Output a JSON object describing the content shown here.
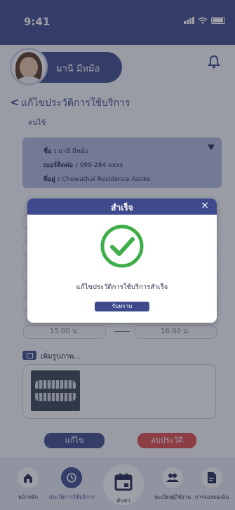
{
  "status_bar": {
    "time": "9:41"
  },
  "profile": {
    "name": "มานี มีหม้อ"
  },
  "page": {
    "back": "<",
    "title": "แก้ไขประวัติการใช้บริการ",
    "patient_section": "คนไข้"
  },
  "patient": {
    "name_label": "ชื่อ :",
    "name_value": "มานี มีหม้อ",
    "phone_label": "เบอร์ติดต่อ :",
    "phone_value": "099-284-xxxx",
    "address_label": "ที่อยู่ :",
    "address_value": "Chewathai Residence Asoke"
  },
  "time_range": {
    "start": "15:00 น.",
    "end": "16:00 น."
  },
  "photo": {
    "add_label": "เพิ่มรูปภาพ..."
  },
  "actions": {
    "edit": "แก้ไข",
    "delete": "ลบประวัติ"
  },
  "nav": {
    "items": [
      {
        "label": "หน้าหลัก",
        "icon": "home-icon"
      },
      {
        "label": "ประวัติการใช้บริการ",
        "icon": "history-icon",
        "active": true
      },
      {
        "label": "ค้นหา",
        "icon": "calendar-icon"
      },
      {
        "label": "ทะเบียนผู้ใช้งาน",
        "icon": "users-icon"
      },
      {
        "label": "การจองของฉัน",
        "icon": "document-icon"
      }
    ]
  },
  "modal": {
    "title": "สำเร็จ",
    "close": "×",
    "message": "แก้ไขประวัติการใช้บริการสำเร็จ",
    "confirm": "รับทราบ"
  },
  "colors": {
    "primary": "#3e4a8c",
    "danger": "#e04b4b",
    "success": "#3fae49",
    "card": "#b3badf"
  }
}
